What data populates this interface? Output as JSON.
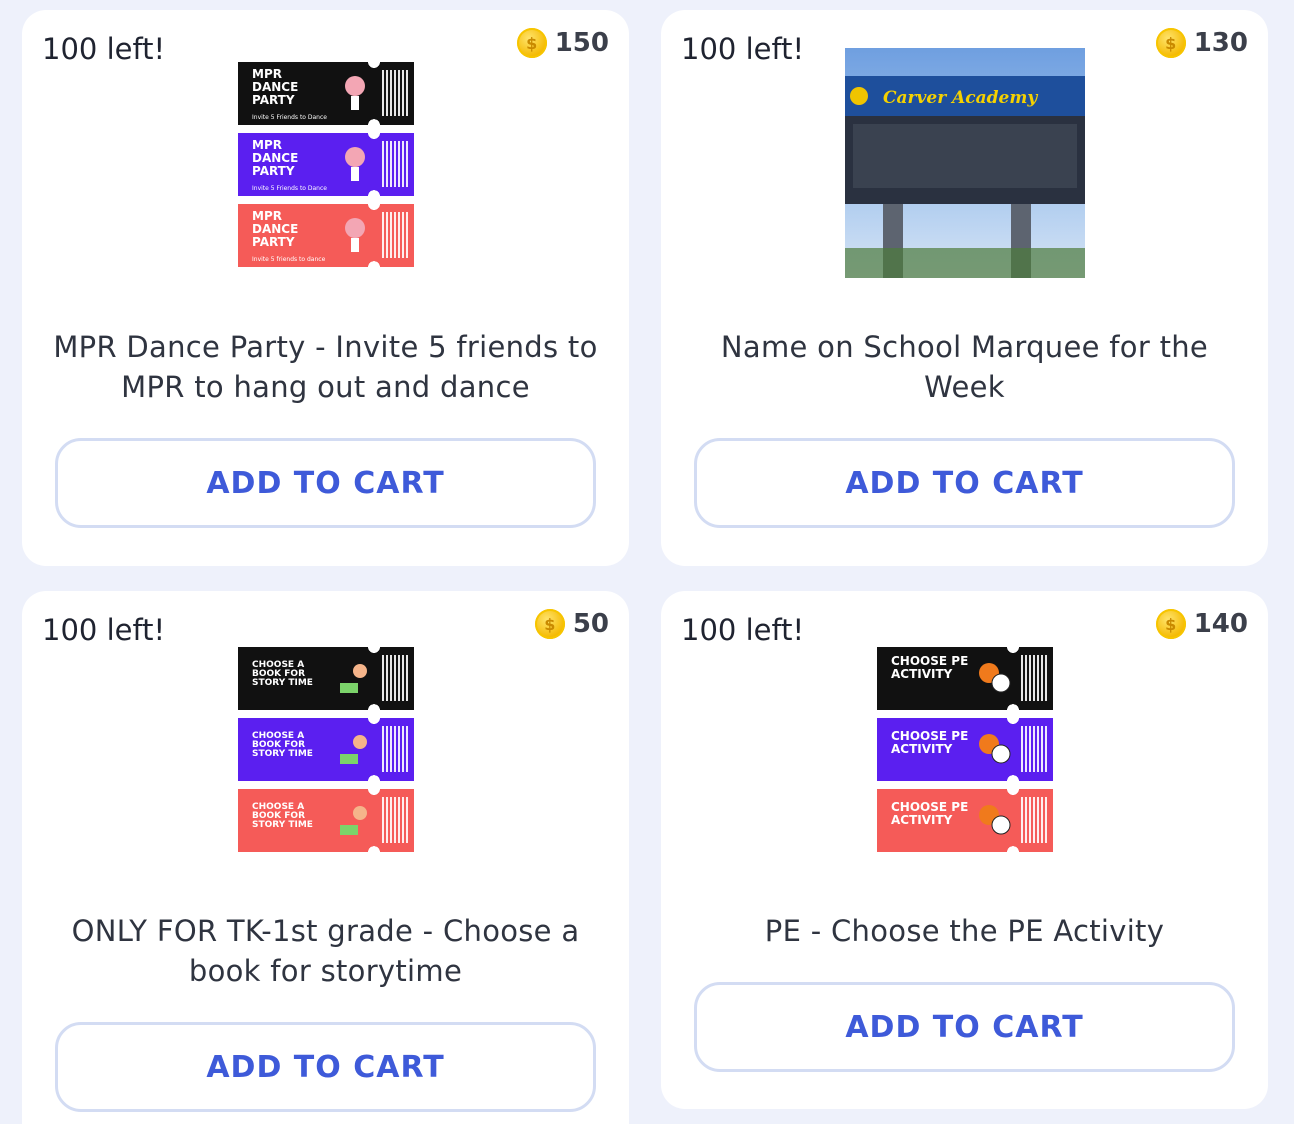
{
  "cards": [
    {
      "stock": "100 left!",
      "price": "150",
      "title": "MPR Dance Party - Invite 5 friends to MPR to hang out and dance",
      "button": "ADD TO CART",
      "tickets": [
        {
          "heading": "MPR DANCE PARTY",
          "sub": "Invite 5 Friends to Dance"
        },
        {
          "heading": "MPR DANCE PARTY",
          "sub": "Invite 5 Friends to Dance"
        },
        {
          "heading": "MPR DANCE PARTY",
          "sub": "Invite 5 friends to dance"
        }
      ]
    },
    {
      "stock": "100 left!",
      "price": "130",
      "title": "Name on School Marquee for the Week",
      "button": "ADD TO CART",
      "marquee_text": "Carver Academy"
    },
    {
      "stock": "100 left!",
      "price": "50",
      "title": "ONLY FOR TK-1st grade - Choose a book for storytime",
      "button": "ADD TO CART",
      "tickets": [
        {
          "heading": "CHOOSE A BOOK FOR STORY TIME"
        },
        {
          "heading": "CHOOSE A BOOK FOR STORY TIME"
        },
        {
          "heading": "CHOOSE A BOOK FOR STORY TIME"
        }
      ]
    },
    {
      "stock": "100 left!",
      "price": "140",
      "title": "PE - Choose the PE Activity",
      "button": "ADD TO CART",
      "tickets": [
        {
          "heading": "CHOOSE PE ACTIVITY"
        },
        {
          "heading": "CHOOSE PE ACTIVITY"
        },
        {
          "heading": "CHOOSE PE ACTIVITY"
        }
      ]
    }
  ],
  "colors": {
    "accent": "#3e5ad9",
    "button_border": "#d3dcf3",
    "page_bg": "#eef1fb",
    "coin": "#f4b800"
  },
  "icons": {
    "price": "coin-icon"
  }
}
